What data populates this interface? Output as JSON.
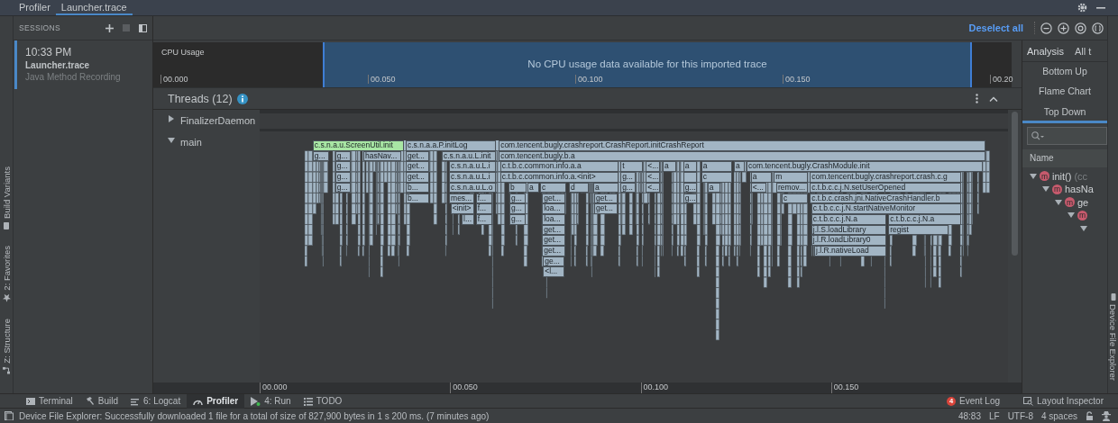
{
  "tabs": [
    {
      "label": "Profiler",
      "selected": false
    },
    {
      "label": "Launcher.trace",
      "selected": true
    }
  ],
  "left_strip": [
    {
      "label": "Build Variants",
      "kind": "variants"
    },
    {
      "label": "2: Favorites",
      "kind": "favorites"
    },
    {
      "label": "Z: Structure",
      "kind": "structure"
    }
  ],
  "right_strip": [
    {
      "label": "Device File Explorer",
      "kind": "device"
    }
  ],
  "sessions": {
    "title": "SESSIONS",
    "items": [
      {
        "time": "10:33 PM",
        "name": "Launcher.trace",
        "type": "Java Method Recording",
        "selected": true
      }
    ]
  },
  "toolbar": {
    "deselect": "Deselect all"
  },
  "cpu_usage": {
    "title": "CPU Usage",
    "message": "No CPU usage data available for this imported trace",
    "xticks": [
      "00.000",
      "00.050",
      "00.100",
      "00.150",
      "00.20"
    ]
  },
  "threads": {
    "title": "Threads (12)",
    "items": [
      {
        "name": "FinalizerDaemon",
        "expanded": false
      },
      {
        "name": "main",
        "expanded": true
      }
    ]
  },
  "flame_chart": {
    "xticks": [
      "00.000",
      "00.050",
      "00.100",
      "00.150"
    ],
    "frames": [
      {
        "label": "c.s.n.a.u.ScreenUtil.init",
        "selected": true,
        "children": [
          {
            "label": "g...",
            "selected": false
          },
          {
            "label": "g...",
            "selected": false,
            "children": [
              {
                "label": "g...",
                "selected": false,
                "children": [
                  {
                    "label": "g...",
                    "selected": false,
                    "children": [
                      {
                        "label": "g...",
                        "selected": false
                      }
                    ]
                  }
                ]
              }
            ]
          },
          {
            "label": "hasNav...",
            "selected": false
          }
        ]
      },
      {
        "label": "c.s.n.a.a.P.initLog",
        "selected": false,
        "children": [
          {
            "label": "get...",
            "selected": false,
            "children": [
              {
                "label": "get...",
                "selected": false,
                "children": [
                  {
                    "label": "get...",
                    "selected": false,
                    "children": [
                      {
                        "label": "b...",
                        "selected": false,
                        "children": [
                          {
                            "label": "b...",
                            "selected": false
                          }
                        ]
                      }
                    ]
                  }
                ]
              }
            ]
          },
          {
            "label": "c.s.n.a.u.L.init",
            "selected": false,
            "children": [
              {
                "label": "c.s.n.a.u.L.i",
                "selected": false,
                "children": [
                  {
                    "label": "c.s.n.a.u.L.i",
                    "selected": false,
                    "children": [
                      {
                        "label": "c.s.n.a.u.L.o",
                        "selected": false,
                        "children": [
                          {
                            "label": "mes...",
                            "selected": false,
                            "children": [
                              {
                                "label": "<init>",
                                "selected": false,
                                "children": [
                                  {
                                    "label": "l...",
                                    "selected": false
                                  }
                                ]
                              }
                            ]
                          },
                          {
                            "label": "f...",
                            "selected": false,
                            "children": [
                              {
                                "label": "f...",
                                "selected": false,
                                "children": [
                                  {
                                    "label": "f...",
                                    "selected": false
                                  }
                                ]
                              }
                            ]
                          }
                        ]
                      }
                    ]
                  }
                ]
              }
            ]
          }
        ]
      },
      {
        "label": "com.tencent.bugly.crashreport.CrashReport.initCrashReport",
        "selected": false,
        "children": [
          {
            "label": "com.tencent.bugly.b.a",
            "selected": false,
            "children": [
              {
                "label": "c.t.b.c.common.info.a.a",
                "selected": false,
                "children": [
                  {
                    "label": "c.t.b.c.common.info.a.<init>",
                    "selected": false,
                    "children": [
                      {
                        "label": "b",
                        "selected": false,
                        "children": [
                          {
                            "label": "g...",
                            "selected": false,
                            "children": [
                              {
                                "label": "g...",
                                "selected": false,
                                "children": [
                                  {
                                    "label": "g...",
                                    "selected": false
                                  }
                                ]
                              }
                            ]
                          }
                        ]
                      },
                      {
                        "label": "a",
                        "selected": false
                      },
                      {
                        "label": "c",
                        "selected": false,
                        "children": [
                          {
                            "label": "get...",
                            "selected": false,
                            "children": [
                              {
                                "label": "loa...",
                                "selected": false,
                                "children": [
                                  {
                                    "label": "loa...",
                                    "selected": false,
                                    "children": [
                                      {
                                        "label": "get...",
                                        "selected": false,
                                        "children": [
                                          {
                                            "label": "get...",
                                            "selected": false,
                                            "children": [
                                              {
                                                "label": "get...",
                                                "selected": false,
                                                "children": [
                                                  {
                                                    "label": "ge...",
                                                    "selected": false,
                                                    "children": [
                                                      {
                                                        "label": "<l...",
                                                        "selected": false
                                                      }
                                                    ]
                                                  }
                                                ]
                                              }
                                            ]
                                          }
                                        ]
                                      }
                                    ]
                                  }
                                ]
                              }
                            ]
                          }
                        ]
                      },
                      {
                        "label": "d",
                        "selected": false
                      },
                      {
                        "label": "a",
                        "selected": false,
                        "children": [
                          {
                            "label": "get...",
                            "selected": false,
                            "children": [
                              {
                                "label": "get...",
                                "selected": false
                              }
                            ]
                          }
                        ]
                      }
                    ]
                  }
                ]
              },
              {
                "label": "t",
                "selected": false,
                "children": [
                  {
                    "label": "g...",
                    "selected": false,
                    "children": [
                      {
                        "label": "g...",
                        "selected": false
                      }
                    ]
                  }
                ]
              },
              {
                "label": "<...",
                "selected": false,
                "children": [
                  {
                    "label": "<...",
                    "selected": false,
                    "children": [
                      {
                        "label": "<...",
                        "selected": false
                      }
                    ]
                  }
                ]
              },
              {
                "label": "a",
                "selected": false
              },
              {
                "label": "a",
                "selected": false,
                "children": [
                  {
                    "selected": false,
                    "children": [
                      {
                        "label": "g...",
                        "selected": false,
                        "children": [
                          {
                            "label": "g...",
                            "selected": false
                          }
                        ]
                      }
                    ]
                  }
                ]
              },
              {
                "label": "a",
                "selected": false,
                "children": [
                  {
                    "label": "c",
                    "selected": false,
                    "children": [
                      {
                        "label": "a",
                        "selected": false
                      }
                    ]
                  }
                ]
              },
              {
                "label": "a",
                "selected": false
              },
              {
                "label": "com.tencent.bugly.CrashModule.init",
                "selected": false,
                "children": [
                  {
                    "label": "a",
                    "selected": false,
                    "children": [
                      {
                        "label": "<...",
                        "selected": false
                      }
                    ]
                  },
                  {
                    "label": "m",
                    "selected": false,
                    "children": [
                      {
                        "label": "remov...",
                        "selected": false,
                        "children": [
                          {
                            "label": "c",
                            "selected": false
                          }
                        ]
                      }
                    ]
                  },
                  {
                    "label": "com.tencent.bugly.crashreport.crash.c.g",
                    "selected": false,
                    "children": [
                      {
                        "label": "c.t.b.c.c.j.N.setUserOpened",
                        "selected": false,
                        "children": [
                          {
                            "label": "c.t.b.c.crash.jni.NativeCrashHandler.b",
                            "selected": false,
                            "children": [
                              {
                                "label": "c.t.b.c.c.j.N.startNativeMonitor",
                                "selected": false,
                                "children": [
                                  {
                                    "label": "c.t.b.c.c.j.N.a",
                                    "selected": false,
                                    "children": [
                                      {
                                        "label": "j.l.S.loadLibrary",
                                        "selected": false,
                                        "children": [
                                          {
                                            "label": "j.l.R.loadLibrary0",
                                            "selected": false,
                                            "children": [
                                              {
                                                "label": "j.l.R.nativeLoad",
                                                "selected": false
                                              }
                                            ]
                                          }
                                        ]
                                      }
                                    ]
                                  },
                                  {
                                    "label": "c.t.b.c.c.j.N.a",
                                    "selected": false,
                                    "children": [
                                      {
                                        "label": "regist",
                                        "selected": false
                                      }
                                    ]
                                  }
                                ]
                              }
                            ]
                          }
                        ]
                      }
                    ]
                  }
                ]
              }
            ]
          }
        ]
      }
    ]
  },
  "analysis": {
    "tabs": [
      {
        "label": "Analysis",
        "selected": true
      },
      {
        "label": "All t",
        "selected": false
      }
    ],
    "views": [
      {
        "label": "Bottom Up",
        "selected": false
      },
      {
        "label": "Flame Chart",
        "selected": false
      },
      {
        "label": "Top Down",
        "selected": true
      }
    ],
    "column": "Name",
    "tree": [
      {
        "name": "init()",
        "detail": "(cc",
        "kind": "method",
        "badge": "m",
        "expanded": true,
        "children": [
          {
            "name": "hasNa",
            "kind": "method",
            "badge": "m",
            "expanded": true,
            "children": [
              {
                "name": "ge",
                "kind": "method",
                "badge": "m",
                "expanded": true,
                "children": [
                  {
                    "kind": "method",
                    "badge": "m",
                    "expanded": true,
                    "children": [
                      {
                        "expanded": true
                      }
                    ]
                  }
                ]
              }
            ]
          }
        ]
      }
    ]
  },
  "tool_windows": [
    {
      "label": "Terminal",
      "kind": "terminal",
      "selected": false
    },
    {
      "label": "Build",
      "kind": "build",
      "selected": false
    },
    {
      "label": "6: Logcat",
      "kind": "logcat",
      "selected": false
    },
    {
      "label": "Profiler",
      "kind": "profiler",
      "selected": true
    },
    {
      "label": "4: Run",
      "kind": "run",
      "selected": false
    },
    {
      "label": "TODO",
      "kind": "todo",
      "selected": false
    }
  ],
  "event_log": {
    "count": "4",
    "label": "Event Log"
  },
  "layout_inspector": {
    "label": "Layout Inspector"
  },
  "status_bar": {
    "message": "Device File Explorer: Successfully downloaded 1 file for a total of size of 827,900 bytes in 1 s 200 ms. (7 minutes ago)",
    "position": "48:83",
    "line_ending": "LF",
    "encoding": "UTF-8",
    "indent": "4 spaces"
  }
}
